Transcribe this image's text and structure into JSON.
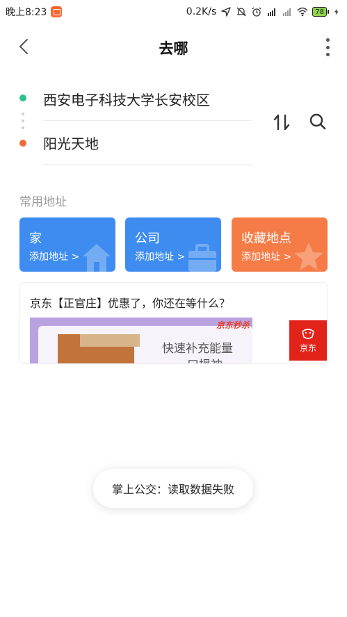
{
  "status_bar": {
    "time": "晚上8:23",
    "net_speed": "0.2K/s",
    "battery": "78"
  },
  "header": {
    "title": "去哪"
  },
  "route": {
    "start": "西安电子科技大学长安校区",
    "end": "阳光天地"
  },
  "common_addresses": {
    "label": "常用地址",
    "items": [
      {
        "name": "家",
        "sub": "添加地址 >"
      },
      {
        "name": "公司",
        "sub": "添加地址 >"
      },
      {
        "name": "收藏地点",
        "sub": "添加地址 >"
      }
    ]
  },
  "ad": {
    "text": "京东【正官庄】优惠了，你还在等什么？",
    "promo": "京东秒杀",
    "slogan": "快速补充能量",
    "slogan2": "口提神",
    "logo": "京东"
  },
  "toast": {
    "text": "掌上公交：读取数据失败"
  },
  "colors": {
    "start_dot": "#2bc28b",
    "end_dot": "#f36a3a",
    "blue_card": "#3f8cf0",
    "orange_card": "#f57c47"
  }
}
